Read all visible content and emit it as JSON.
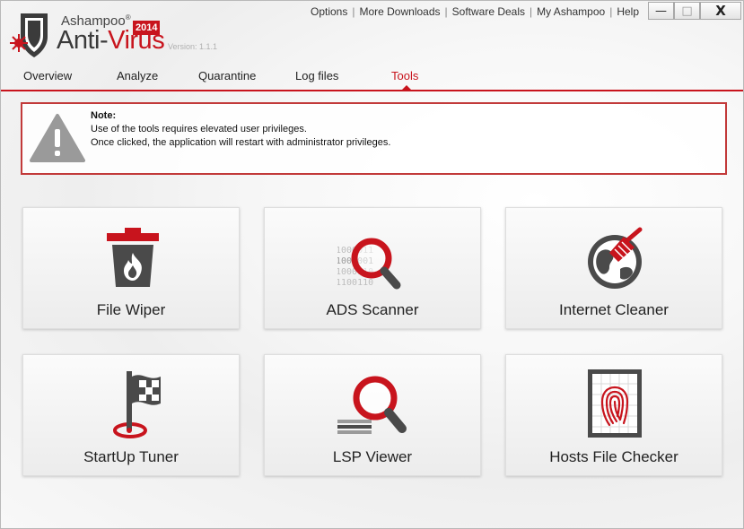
{
  "app": {
    "brand_small": "Ashampoo",
    "brand_registered": "®",
    "brand_big_prefix": "Anti-",
    "brand_big_accent": "Virus",
    "year_badge": "2014",
    "version": "Version: 1.1.1"
  },
  "top_menu": {
    "items": [
      "Options",
      "More Downloads",
      "Software Deals",
      "My Ashampoo",
      "Help"
    ],
    "separator": "|"
  },
  "window_controls": {
    "minimize": "—",
    "maximize": "□",
    "close": "X"
  },
  "tabs": [
    {
      "label": "Overview",
      "active": false
    },
    {
      "label": "Analyze",
      "active": false
    },
    {
      "label": "Quarantine",
      "active": false
    },
    {
      "label": "Log files",
      "active": false
    },
    {
      "label": "Tools",
      "active": true
    }
  ],
  "note": {
    "title": "Note:",
    "line1": "Use of the tools requires elevated user privileges.",
    "line2": "Once clicked, the application will restart with administrator privileges.",
    "icon": "warning-icon"
  },
  "tools": [
    {
      "label": "File Wiper",
      "icon": "trash-fire-icon"
    },
    {
      "label": "ADS Scanner",
      "icon": "binary-magnifier-icon"
    },
    {
      "label": "Internet Cleaner",
      "icon": "globe-broom-icon"
    },
    {
      "label": "StartUp Tuner",
      "icon": "flag-icon"
    },
    {
      "label": "LSP Viewer",
      "icon": "layers-magnifier-icon"
    },
    {
      "label": "Hosts File Checker",
      "icon": "fingerprint-icon"
    }
  ],
  "colors": {
    "accent": "#c8141d",
    "dark_icon": "#4a4a4a"
  },
  "binary_text": [
    "1000011",
    "1000001",
    "1000110",
    "1100110"
  ]
}
